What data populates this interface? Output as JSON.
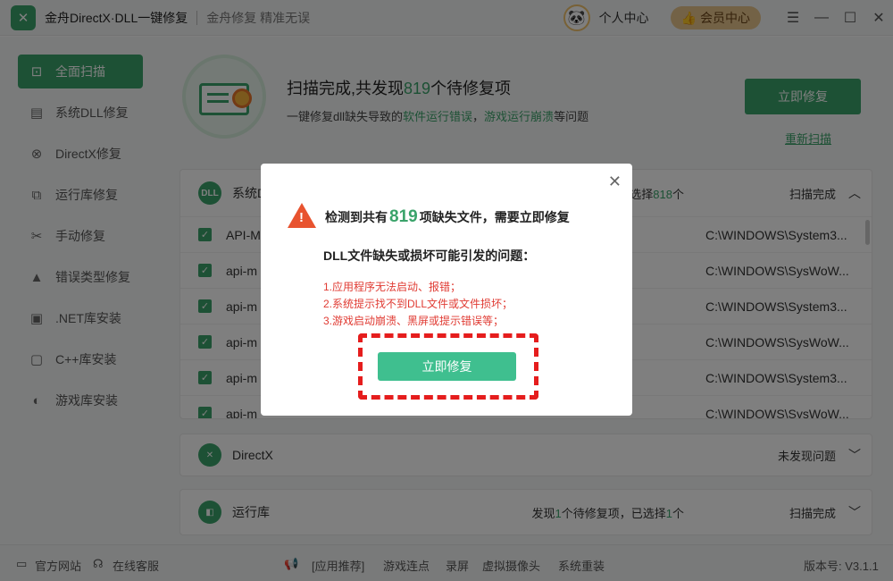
{
  "titlebar": {
    "app_title": "金舟DirectX·DLL一键修复",
    "slogan": "金舟修复 精准无误",
    "user_center": "个人中心",
    "vip": "会员中心"
  },
  "sidebar": {
    "items": [
      {
        "label": "全面扫描",
        "icon": "scan-icon"
      },
      {
        "label": "系统DLL修复",
        "icon": "dll-icon"
      },
      {
        "label": "DirectX修复",
        "icon": "directx-icon"
      },
      {
        "label": "运行库修复",
        "icon": "runtime-icon"
      },
      {
        "label": "手动修复",
        "icon": "wrench-icon"
      },
      {
        "label": "错误类型修复",
        "icon": "warning-icon"
      },
      {
        "label": ".NET库安装",
        "icon": "dotnet-icon"
      },
      {
        "label": "C++库安装",
        "icon": "cpp-icon"
      },
      {
        "label": "游戏库安装",
        "icon": "game-icon"
      }
    ]
  },
  "scan": {
    "title_pre": "扫描完成,共发现",
    "count": "819",
    "title_post": "个待修复项",
    "sub_pre": "一键修复dll缺失导致的",
    "sub_hl1": "软件运行错误",
    "sub_mid": "，",
    "sub_hl2": "游戏运行崩溃",
    "sub_post": "等问题",
    "fix_button": "立即修复",
    "rescan": "重新扫描"
  },
  "dll_panel": {
    "title": "系统D",
    "info_pre": "选择",
    "info_count": "818",
    "info_post": "个",
    "status": "扫描完成",
    "rows": [
      {
        "name": "API-M",
        "path": "C:\\WINDOWS\\System3..."
      },
      {
        "name": "api-m",
        "path": "C:\\WINDOWS\\SysWoW..."
      },
      {
        "name": "api-m",
        "path": "C:\\WINDOWS\\System3..."
      },
      {
        "name": "api-m",
        "path": "C:\\WINDOWS\\SysWoW..."
      },
      {
        "name": "api-m",
        "path": "C:\\WINDOWS\\System3..."
      },
      {
        "name": "api-m",
        "path": "C:\\WINDOWS\\SysWoW..."
      }
    ]
  },
  "directx_panel": {
    "title": "DirectX",
    "status": "未发现问题"
  },
  "runtime_panel": {
    "title": "运行库",
    "info_pre": "发现",
    "count1": "1",
    "info_mid": "个待修复项，已选择",
    "count2": "1",
    "info_post": "个",
    "status": "扫描完成"
  },
  "modal": {
    "title_pre": "检测到共有",
    "count": "819",
    "title_post": "项缺失文件，需要立即修复",
    "subtitle": "DLL文件缺失或损坏可能引发的问题：",
    "issues": [
      "1.应用程序无法启动、报错；",
      "2.系统提示找不到DLL文件或文件损坏；",
      "3.游戏启动崩溃、黑屏或提示错误等；"
    ],
    "button": "立即修复"
  },
  "footer": {
    "website": "官方网站",
    "service": "在线客服",
    "recommend": "[应用推荐]",
    "links": [
      "游戏连点",
      "录屏",
      "虚拟摄像头",
      "系统重装"
    ],
    "version": "版本号: V3.1.1"
  },
  "colors": {
    "accent": "#3aa36a",
    "danger": "#e51d1d",
    "modal_button": "#3fbf8f"
  }
}
